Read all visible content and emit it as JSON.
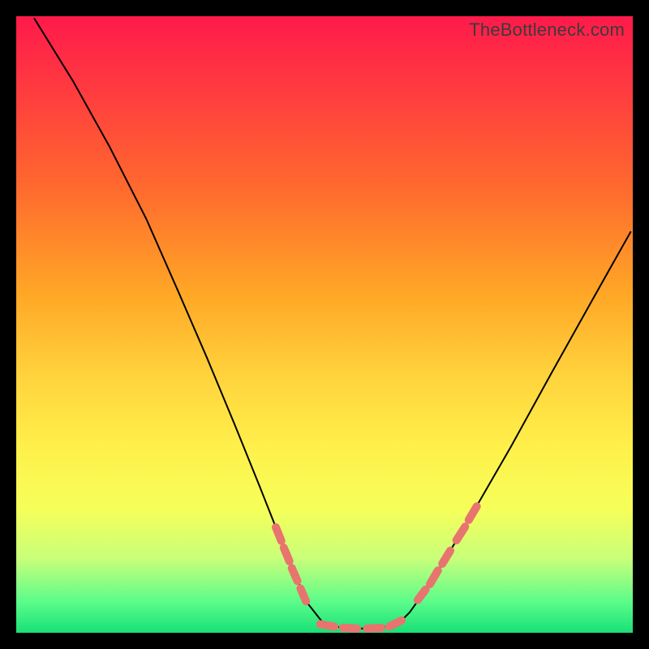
{
  "credit": "TheBottleneck.com",
  "colors": {
    "curve": "#000000",
    "marker": "#e8746f"
  },
  "chart_data": {
    "type": "line",
    "title": "",
    "xlabel": "",
    "ylabel": "",
    "xlim": [
      0,
      100
    ],
    "ylim": [
      0,
      100
    ],
    "grid": false,
    "description": "V-shaped bottleneck curve; trough near ~55% of x-axis; no visible numeric axis labels",
    "curve_points": [
      {
        "x": 2.9,
        "y": 99.7
      },
      {
        "x": 9.2,
        "y": 89.5
      },
      {
        "x": 15.1,
        "y": 78.9
      },
      {
        "x": 21.1,
        "y": 67.1
      },
      {
        "x": 26.3,
        "y": 55.3
      },
      {
        "x": 30.9,
        "y": 44.7
      },
      {
        "x": 35.5,
        "y": 33.6
      },
      {
        "x": 39.5,
        "y": 23.7
      },
      {
        "x": 42.1,
        "y": 17.1
      },
      {
        "x": 44.7,
        "y": 10.5
      },
      {
        "x": 47.4,
        "y": 4.6
      },
      {
        "x": 50.0,
        "y": 1.3
      },
      {
        "x": 53.9,
        "y": 0.7
      },
      {
        "x": 57.9,
        "y": 0.7
      },
      {
        "x": 61.8,
        "y": 1.3
      },
      {
        "x": 63.8,
        "y": 3.3
      },
      {
        "x": 67.1,
        "y": 7.9
      },
      {
        "x": 71.1,
        "y": 14.5
      },
      {
        "x": 75.0,
        "y": 21.1
      },
      {
        "x": 80.3,
        "y": 30.3
      },
      {
        "x": 86.8,
        "y": 42.1
      },
      {
        "x": 93.4,
        "y": 53.9
      },
      {
        "x": 99.7,
        "y": 65.1
      }
    ],
    "markers": {
      "description": "Pink rounded dash segments along portions of the curve near the trough",
      "left_branch": [
        {
          "x1": 42.1,
          "y1": 17.1,
          "x2": 43.0,
          "y2": 14.9
        },
        {
          "x1": 43.4,
          "y1": 13.8,
          "x2": 44.3,
          "y2": 11.6
        },
        {
          "x1": 44.7,
          "y1": 10.5,
          "x2": 45.6,
          "y2": 8.4
        },
        {
          "x1": 46.1,
          "y1": 7.2,
          "x2": 47.0,
          "y2": 5.1
        }
      ],
      "trough": [
        {
          "x1": 49.3,
          "y1": 1.4,
          "x2": 51.6,
          "y2": 1.0
        },
        {
          "x1": 53.0,
          "y1": 0.8,
          "x2": 55.3,
          "y2": 0.7
        },
        {
          "x1": 56.9,
          "y1": 0.7,
          "x2": 59.2,
          "y2": 0.8
        },
        {
          "x1": 60.5,
          "y1": 1.0,
          "x2": 62.5,
          "y2": 2.0
        }
      ],
      "right_branch": [
        {
          "x1": 65.1,
          "y1": 5.3,
          "x2": 66.4,
          "y2": 7.0
        },
        {
          "x1": 67.1,
          "y1": 7.9,
          "x2": 68.4,
          "y2": 10.1
        },
        {
          "x1": 69.1,
          "y1": 11.2,
          "x2": 70.4,
          "y2": 13.3
        },
        {
          "x1": 71.4,
          "y1": 15.0,
          "x2": 72.8,
          "y2": 17.2
        },
        {
          "x1": 73.4,
          "y1": 18.3,
          "x2": 74.7,
          "y2": 20.5
        }
      ]
    }
  }
}
